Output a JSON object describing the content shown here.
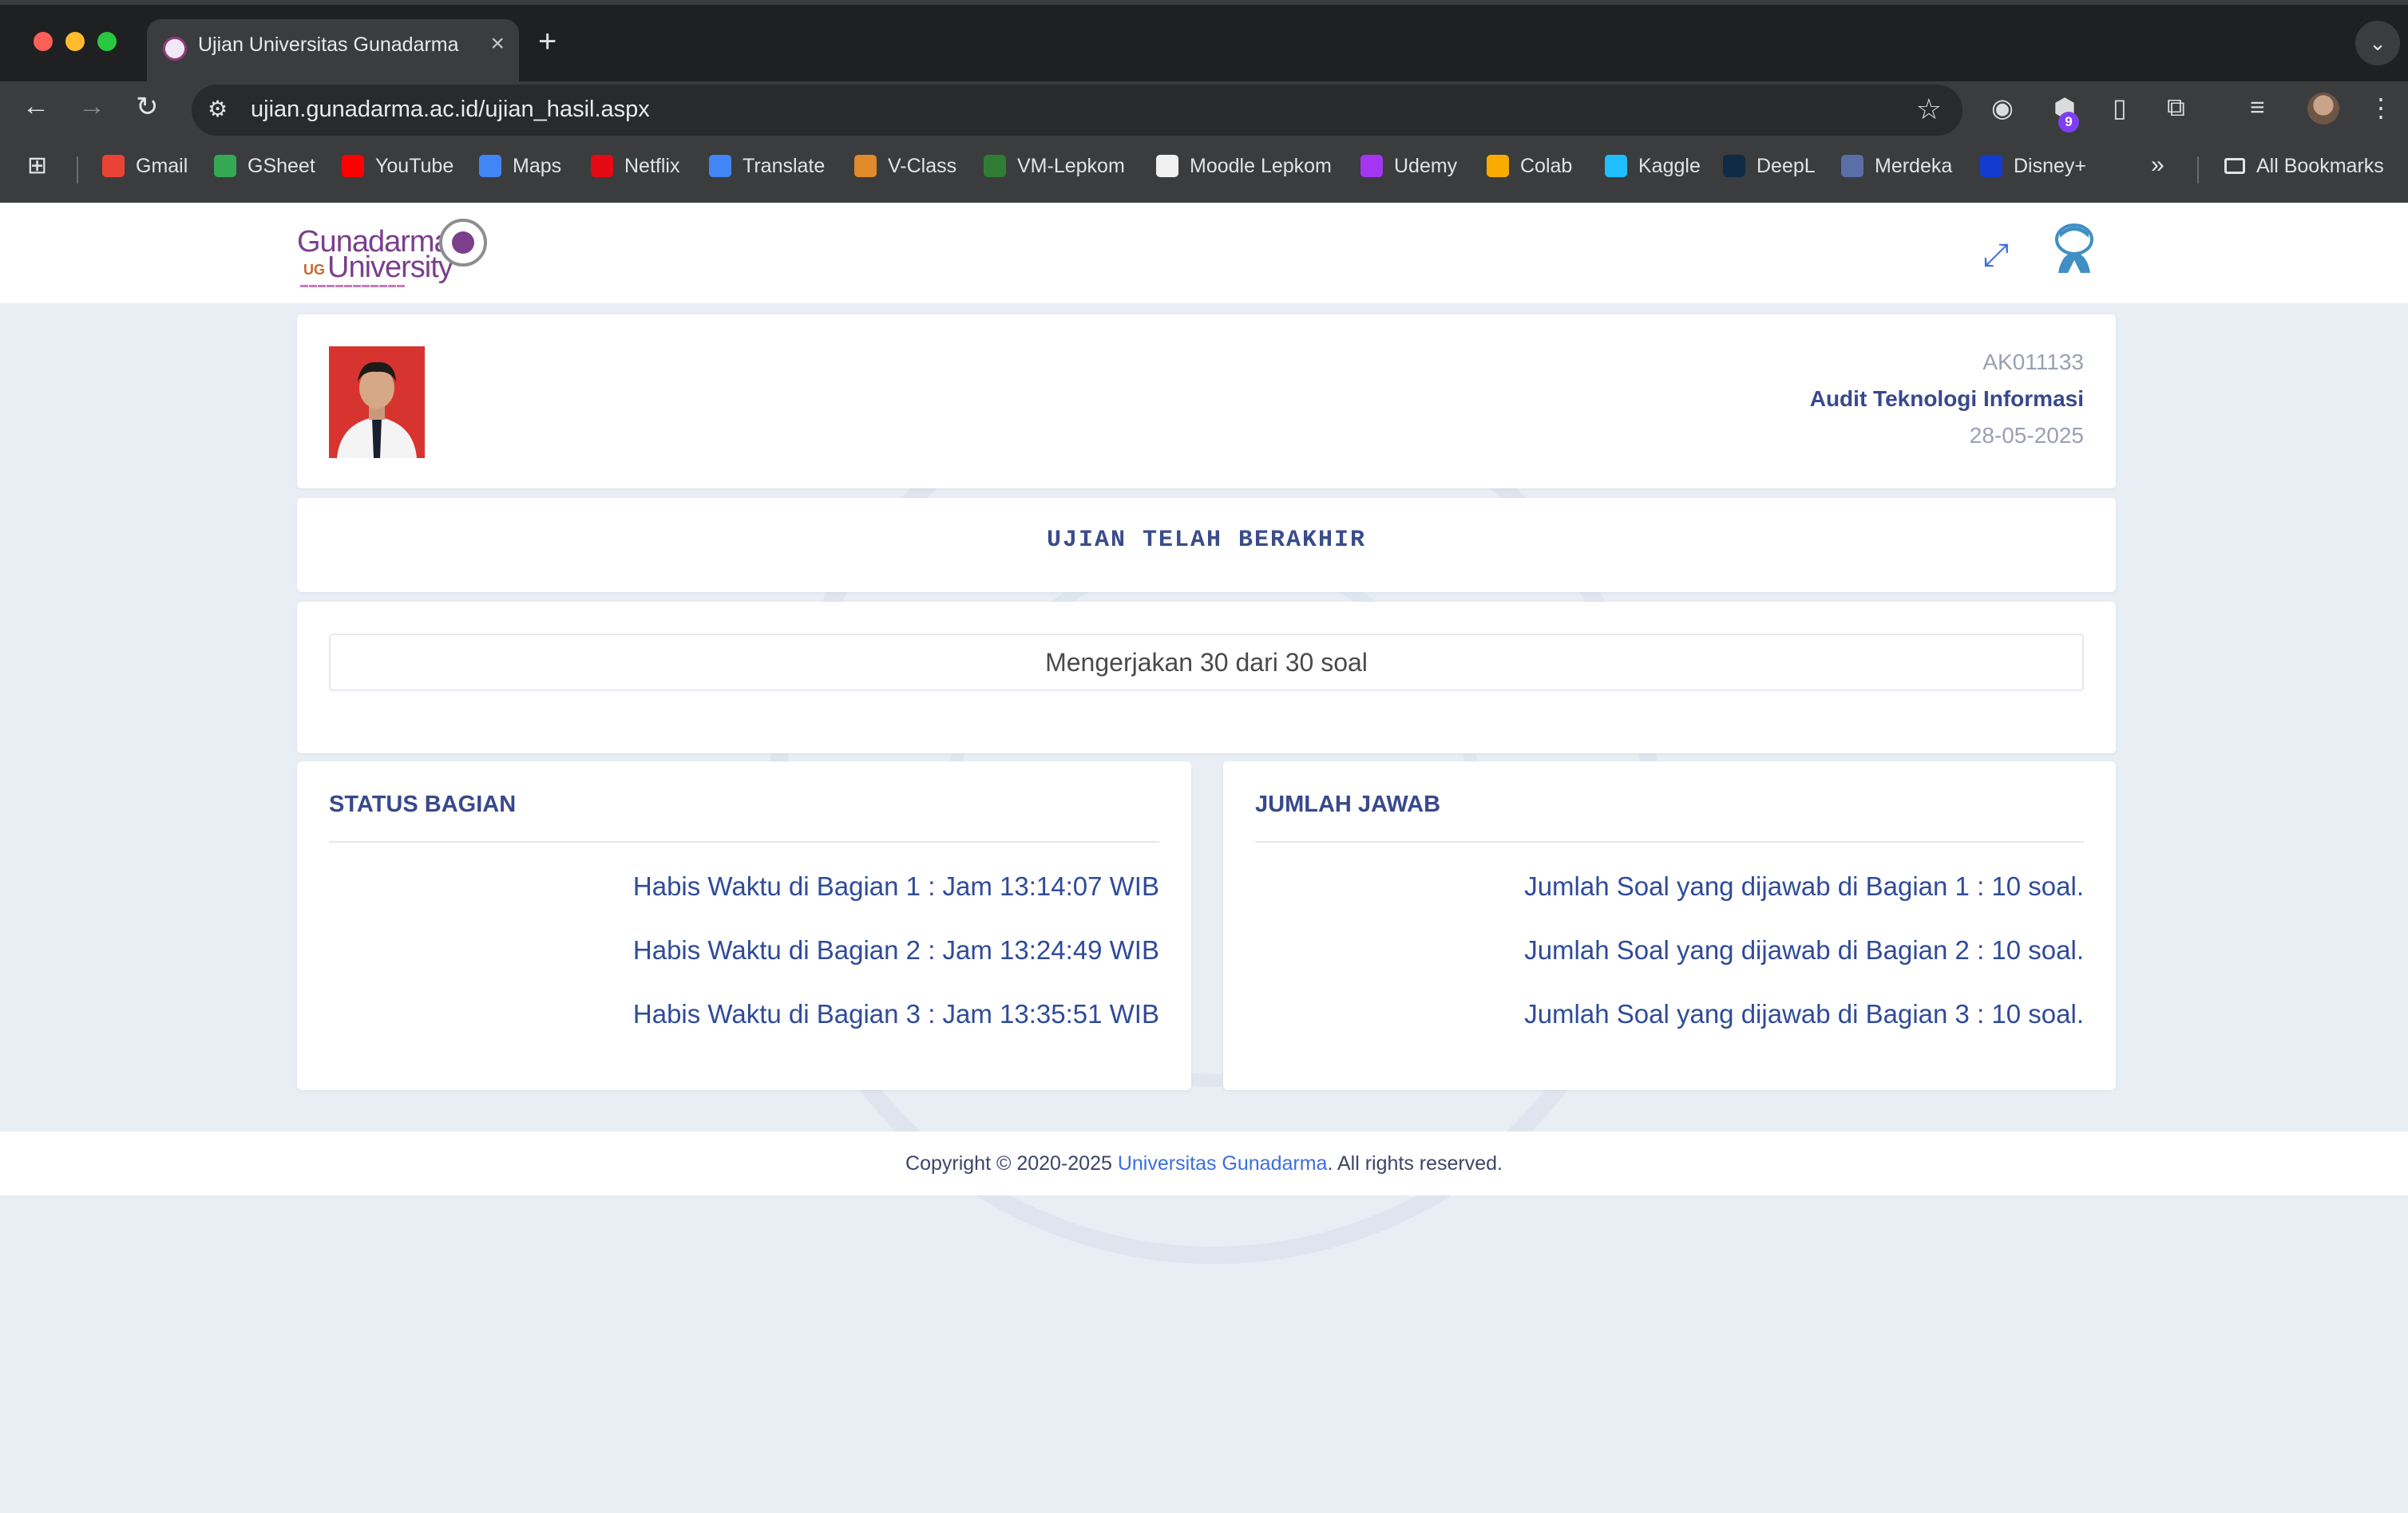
{
  "browser": {
    "tab_title": "Ujian Universitas Gunadarma",
    "url": "ujian.gunadarma.ac.id/ujian_hasil.aspx",
    "extension_badge": "9",
    "bookmarks": [
      {
        "label": "Gmail",
        "icon": "gmail-icon",
        "color": "#ea4335"
      },
      {
        "label": "GSheet",
        "icon": "sheets-icon",
        "color": "#34a853"
      },
      {
        "label": "YouTube",
        "icon": "youtube-icon",
        "color": "#ff0000"
      },
      {
        "label": "Maps",
        "icon": "maps-icon",
        "color": "#4285f4"
      },
      {
        "label": "Netflix",
        "icon": "netflix-icon",
        "color": "#e50914"
      },
      {
        "label": "Translate",
        "icon": "translate-icon",
        "color": "#4285f4"
      },
      {
        "label": "V-Class",
        "icon": "vclass-icon",
        "color": "#e08a2c"
      },
      {
        "label": "VM-Lepkom",
        "icon": "vmlepkom-icon",
        "color": "#2e7d32"
      },
      {
        "label": "Moodle Lepkom",
        "icon": "moodle-icon",
        "color": "#f0f0f0"
      },
      {
        "label": "Udemy",
        "icon": "udemy-icon",
        "color": "#a435f0"
      },
      {
        "label": "Colab",
        "icon": "colab-icon",
        "color": "#f9ab00"
      },
      {
        "label": "Kaggle",
        "icon": "kaggle-icon",
        "color": "#20beff"
      },
      {
        "label": "DeepL",
        "icon": "deepl-icon",
        "color": "#0f2b46"
      },
      {
        "label": "Merdeka",
        "icon": "merdeka-icon",
        "color": "#5a6ea8"
      },
      {
        "label": "Disney+",
        "icon": "disney-icon",
        "color": "#113ccf"
      }
    ],
    "all_bookmarks": "All Bookmarks"
  },
  "header": {
    "logo_line1": "Gunadarma",
    "logo_line2": "University",
    "logo_ug": "UG"
  },
  "student": {
    "code": "AK011133",
    "subject": "Audit Teknologi Informasi",
    "date": "28-05-2025"
  },
  "status_banner": "UJIAN TELAH BERAKHIR",
  "progress_text": "Mengerjakan 30 dari 30 soal",
  "status_panel": {
    "title": "STATUS BAGIAN",
    "lines": [
      "Habis Waktu di Bagian 1 : Jam 13:14:07 WIB",
      "Habis Waktu di Bagian 2 : Jam 13:24:49 WIB",
      "Habis Waktu di Bagian 3 : Jam 13:35:51 WIB"
    ]
  },
  "answers_panel": {
    "title": "JUMLAH JAWAB",
    "lines": [
      "Jumlah Soal yang dijawab di Bagian 1 : 10 soal.",
      "Jumlah Soal yang dijawab di Bagian 2 : 10 soal.",
      "Jumlah Soal yang dijawab di Bagian 3 : 10 soal."
    ]
  },
  "footer": {
    "prefix": "Copyright © 2020-2025 ",
    "link": "Universitas Gunadarma",
    "suffix": ". All rights reserved."
  }
}
